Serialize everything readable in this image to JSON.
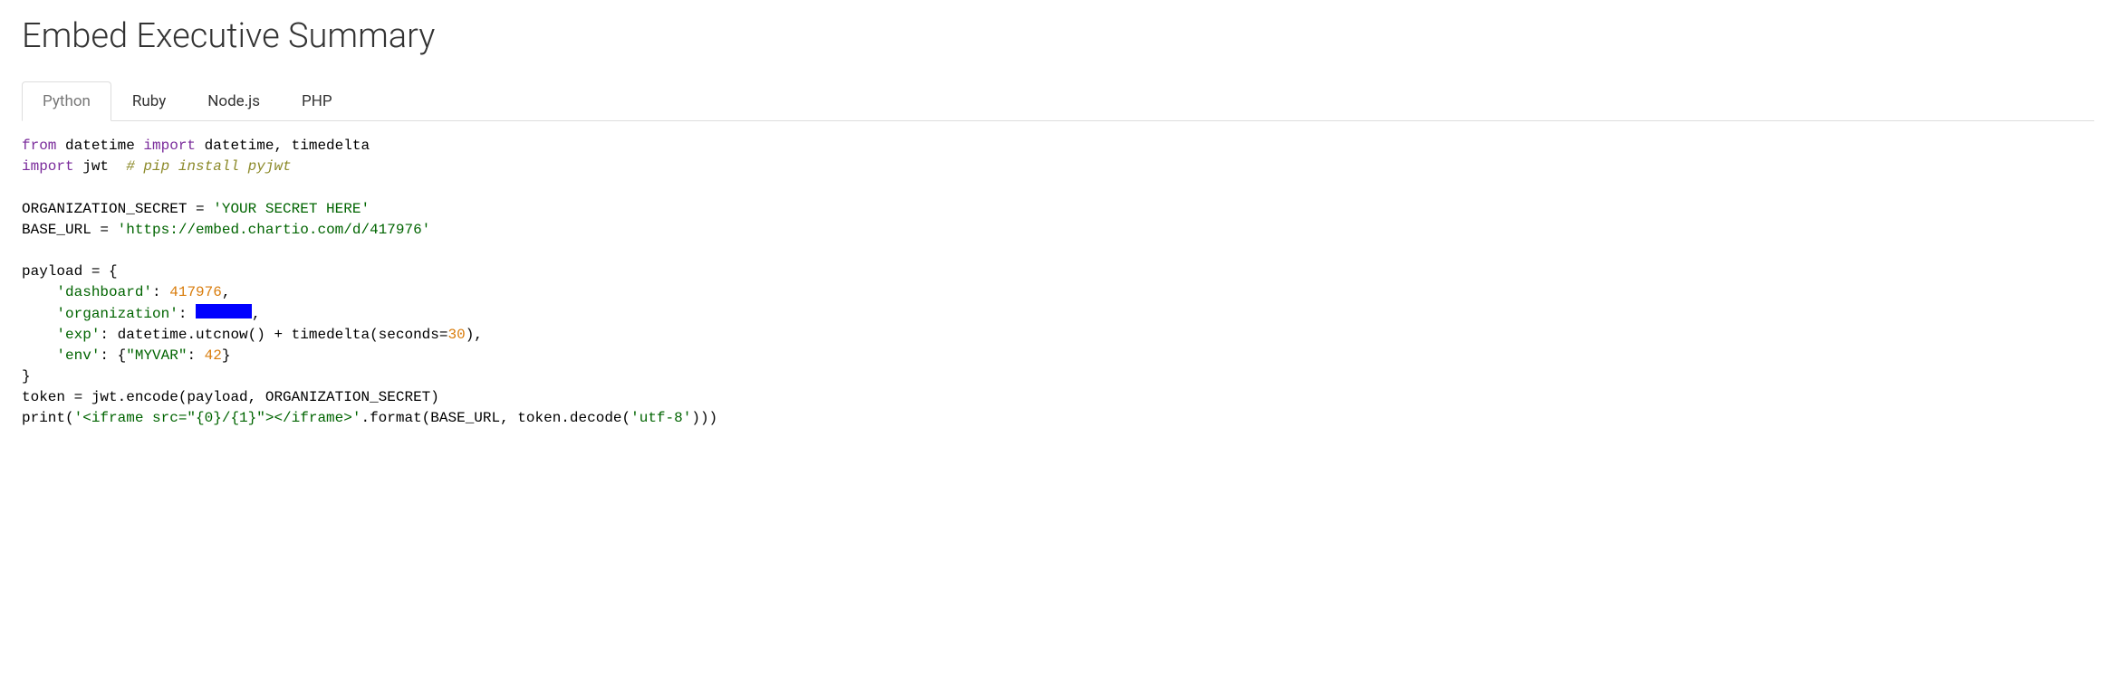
{
  "page": {
    "title": "Embed Executive Summary"
  },
  "tabs": {
    "python": "Python",
    "ruby": "Ruby",
    "nodejs": "Node.js",
    "php": "PHP"
  },
  "code": {
    "kw_from": "from",
    "mod_datetime": " datetime ",
    "kw_import1": "import",
    "imp_datetime": " datetime, timedelta",
    "kw_import2": "import",
    "mod_jwt": " jwt  ",
    "comment_pip": "# pip install pyjwt",
    "line_orgsec_a": "ORGANIZATION_SECRET = ",
    "str_secret": "'YOUR SECRET HERE'",
    "line_baseurl_a": "BASE_URL = ",
    "str_baseurl": "'https://embed.chartio.com/d/417976'",
    "line_payload": "payload = {",
    "indent": "    ",
    "key_dashboard": "'dashboard'",
    "colon": ": ",
    "val_dashboard": "417976",
    "comma": ",",
    "key_organization": "'organization'",
    "key_exp": "'exp'",
    "val_exp": ": datetime.utcnow() + timedelta(seconds=",
    "num_30": "30",
    "close_paren_comma": "),",
    "key_env": "'env'",
    "val_env_open": ": {",
    "str_myvar": "\"MYVAR\"",
    "num_42": "42",
    "close_brace": "}",
    "line_close": "}",
    "line_token": "token = jwt.encode(payload, ORGANIZATION_SECRET)",
    "line_print_a": "print(",
    "str_iframe": "'<iframe src=\"{0}/{1}\"></iframe>'",
    "line_print_b": ".format(BASE_URL, token.decode(",
    "str_utf8": "'utf-8'",
    "line_print_c": ")))"
  }
}
